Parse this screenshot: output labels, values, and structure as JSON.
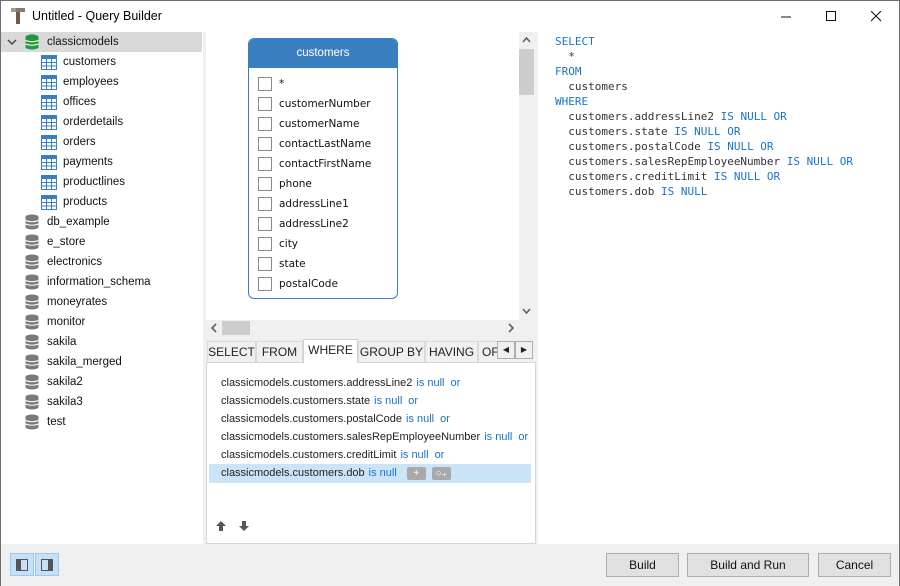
{
  "window": {
    "title": "Untitled - Query Builder",
    "controls": {
      "minimize": "—",
      "maximize": "☐",
      "close": "✕"
    }
  },
  "tree": {
    "expanded_db": {
      "label": "classicmodels",
      "tables": [
        "customers",
        "employees",
        "offices",
        "orderdetails",
        "orders",
        "payments",
        "productlines",
        "products"
      ]
    },
    "databases": [
      "db_example",
      "e_store",
      "electronics",
      "information_schema",
      "moneyrates",
      "monitor",
      "sakila",
      "sakila_merged",
      "sakila2",
      "sakila3",
      "test"
    ],
    "colors": {
      "active_db": "#1f9a3a",
      "db": "#7a7a7a",
      "table": "#3a80c0"
    }
  },
  "diagram": {
    "table": {
      "name": "customers",
      "fields": [
        "*",
        "customerNumber",
        "customerName",
        "contactLastName",
        "contactFirstName",
        "phone",
        "addressLine1",
        "addressLine2",
        "city",
        "state",
        "postalCode"
      ]
    },
    "accent": "#3a80c0"
  },
  "tabs": {
    "items": [
      "SELECT",
      "FROM",
      "WHERE",
      "GROUP BY",
      "HAVING",
      "OF"
    ],
    "active": "WHERE",
    "scroll_left": "◀",
    "scroll_right": "▶"
  },
  "where": {
    "conditions": [
      {
        "column": "classicmodels.customers.addressLine2",
        "op": "is null",
        "conj": "or"
      },
      {
        "column": "classicmodels.customers.state",
        "op": "is null",
        "conj": "or"
      },
      {
        "column": "classicmodels.customers.postalCode",
        "op": "is null",
        "conj": "or"
      },
      {
        "column": "classicmodels.customers.salesRepEmployeeNumber",
        "op": "is null",
        "conj": "or"
      },
      {
        "column": "classicmodels.customers.creditLimit",
        "op": "is null",
        "conj": "or"
      },
      {
        "column": "classicmodels.customers.dob",
        "op": "is null",
        "conj": ""
      }
    ],
    "selected_index": 5,
    "add_condition_label": "+",
    "add_group_label": "○₊",
    "move_up": "🡅",
    "move_down": "🡇"
  },
  "sql": {
    "lines": [
      {
        "indent": "",
        "text": "",
        "kw": "SELECT"
      },
      {
        "indent": "  ",
        "text": "*",
        "kw": ""
      },
      {
        "indent": "",
        "text": "",
        "kw": "FROM"
      },
      {
        "indent": "  ",
        "text": "customers",
        "kw": ""
      },
      {
        "indent": "",
        "text": "",
        "kw": "WHERE"
      },
      {
        "indent": "  ",
        "text": "customers.addressLine2 ",
        "kw": "IS NULL OR"
      },
      {
        "indent": "  ",
        "text": "customers.state ",
        "kw": "IS NULL OR"
      },
      {
        "indent": "  ",
        "text": "customers.postalCode ",
        "kw": "IS NULL OR"
      },
      {
        "indent": "  ",
        "text": "customers.salesRepEmployeeNumber ",
        "kw": "IS NULL OR"
      },
      {
        "indent": "  ",
        "text": "customers.creditLimit ",
        "kw": "IS NULL OR"
      },
      {
        "indent": "  ",
        "text": "customers.dob ",
        "kw": "IS NULL"
      }
    ],
    "keyword_color": "#1a73c9"
  },
  "footer": {
    "build": "Build",
    "build_and_run": "Build and Run",
    "cancel": "Cancel"
  }
}
